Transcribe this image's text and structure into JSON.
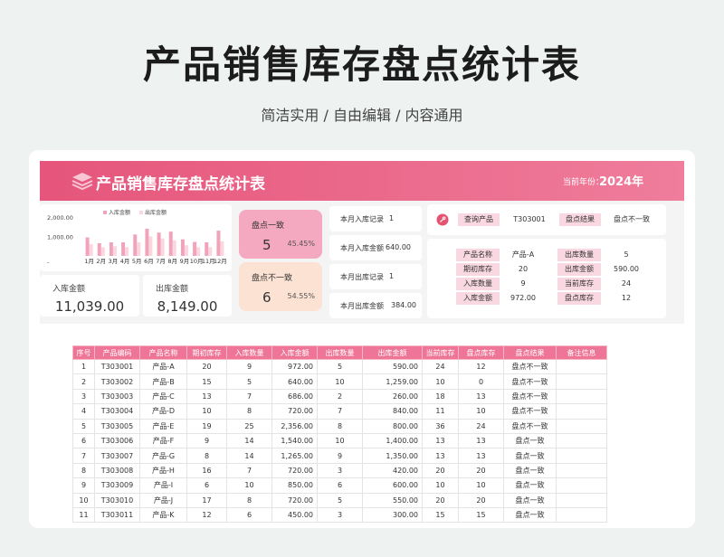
{
  "page": {
    "title": "产品销售库存盘点统计表",
    "subtitle": "简洁实用 / 自由编辑 / 内容通用"
  },
  "banner": {
    "title": "产品销售库存盘点统计表",
    "year_label": "当前年份：",
    "year": "2024年"
  },
  "colors": {
    "accent": "#ef7596",
    "in_bar": "#f1a3ba",
    "out_bar": "#fbd6df",
    "ok_box": "#f5a9c1",
    "bad_box": "#fbe2d3"
  },
  "chart_data": {
    "type": "bar",
    "categories": [
      "1月",
      "2月",
      "3月",
      "4月",
      "5月",
      "6月",
      "7月",
      "8月",
      "9月",
      "10月",
      "11月",
      "12月"
    ],
    "series": [
      {
        "name": "入库金额",
        "values": [
          950,
          650,
          700,
          700,
          1100,
          1400,
          1200,
          1250,
          850,
          720,
          700,
          1300
        ]
      },
      {
        "name": "出库金额",
        "values": [
          600,
          450,
          500,
          450,
          700,
          1000,
          900,
          800,
          550,
          450,
          450,
          750
        ]
      }
    ],
    "y_ticks": [
      "2,000.00",
      "1,000.00",
      "-"
    ],
    "ylim": [
      0,
      2000
    ],
    "legend_position": "top"
  },
  "stats": {
    "in_label": "入库金额",
    "in_value": "11,039.00",
    "out_label": "出库金额",
    "out_value": "8,149.00"
  },
  "check": {
    "ok_label": "盘点一致",
    "ok_count": "5",
    "ok_pct": "45.45%",
    "bad_label": "盘点不一致",
    "bad_count": "6",
    "bad_pct": "54.55%"
  },
  "records": [
    {
      "label": "本月入库记录",
      "value": "1"
    },
    {
      "label": "本月入库金额",
      "value": "640.00"
    },
    {
      "label": "本月出库记录",
      "value": "1"
    },
    {
      "label": "本月出库金额",
      "value": "384.00"
    }
  ],
  "query": {
    "label": "查询产品",
    "value": "T303001",
    "result_label": "盘点结果",
    "result_value": "盘点不一致"
  },
  "detail": {
    "rows": [
      {
        "k1": "产品名称",
        "v1": "产品-A",
        "k2": "出库数量",
        "v2": "5"
      },
      {
        "k1": "期初库存",
        "v1": "20",
        "k2": "出库金额",
        "v2": "590.00"
      },
      {
        "k1": "入库数量",
        "v1": "9",
        "k2": "当前库存",
        "v2": "24"
      },
      {
        "k1": "入库金额",
        "v1": "972.00",
        "k2": "盘点库存",
        "v2": "12"
      }
    ]
  },
  "table": {
    "headers": [
      "序号",
      "产品编码",
      "产品名称",
      "期初库存",
      "入库数量",
      "入库金额",
      "出库数量",
      "出库金额",
      "当前库存",
      "盘点库存",
      "盘点结果",
      "备注信息"
    ],
    "rows": [
      [
        "1",
        "T303001",
        "产品-A",
        "20",
        "9",
        "972.00",
        "5",
        "590.00",
        "24",
        "12",
        "盘点不一致",
        ""
      ],
      [
        "2",
        "T303002",
        "产品-B",
        "15",
        "5",
        "640.00",
        "10",
        "1,259.00",
        "10",
        "0",
        "盘点不一致",
        ""
      ],
      [
        "3",
        "T303003",
        "产品-C",
        "13",
        "7",
        "686.00",
        "2",
        "260.00",
        "18",
        "13",
        "盘点不一致",
        ""
      ],
      [
        "4",
        "T303004",
        "产品-D",
        "10",
        "8",
        "720.00",
        "7",
        "840.00",
        "11",
        "10",
        "盘点不一致",
        ""
      ],
      [
        "5",
        "T303005",
        "产品-E",
        "19",
        "25",
        "2,356.00",
        "8",
        "800.00",
        "36",
        "24",
        "盘点不一致",
        ""
      ],
      [
        "6",
        "T303006",
        "产品-F",
        "9",
        "14",
        "1,540.00",
        "10",
        "1,400.00",
        "13",
        "13",
        "盘点一致",
        ""
      ],
      [
        "7",
        "T303007",
        "产品-G",
        "8",
        "14",
        "1,265.00",
        "9",
        "1,350.00",
        "13",
        "13",
        "盘点一致",
        ""
      ],
      [
        "8",
        "T303008",
        "产品-H",
        "16",
        "7",
        "720.00",
        "3",
        "420.00",
        "20",
        "20",
        "盘点一致",
        ""
      ],
      [
        "9",
        "T303009",
        "产品-I",
        "6",
        "10",
        "850.00",
        "6",
        "600.00",
        "10",
        "10",
        "盘点一致",
        ""
      ],
      [
        "10",
        "T303010",
        "产品-J",
        "17",
        "8",
        "720.00",
        "5",
        "550.00",
        "20",
        "20",
        "盘点一致",
        ""
      ],
      [
        "11",
        "T303011",
        "产品-K",
        "12",
        "6",
        "450.00",
        "3",
        "300.00",
        "15",
        "15",
        "盘点一致",
        ""
      ]
    ]
  }
}
